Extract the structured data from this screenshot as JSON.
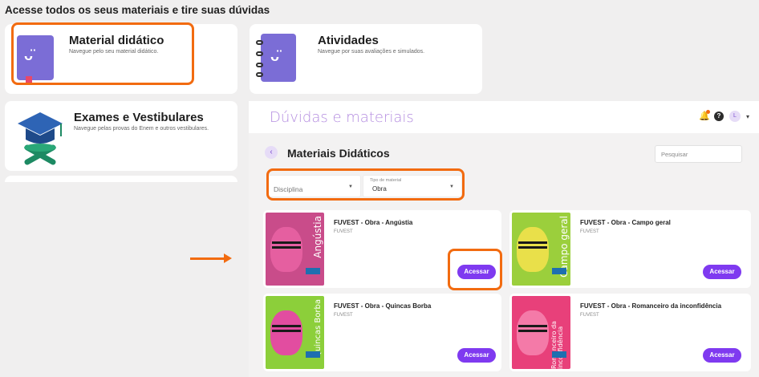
{
  "heading": "Acesse todos os seus materiais e tire suas dúvidas",
  "cards": {
    "material": {
      "title": "Material didático",
      "desc": "Navegue pelo seu material didático."
    },
    "atividades": {
      "title": "Atividades",
      "desc": "Navegue por suas avaliações e simulados."
    },
    "exames": {
      "title": "Exames e Vestibulares",
      "desc": "Navegue pelas provas do Enem e outros vestibulares."
    }
  },
  "panel": {
    "brand": "Dúvidas e materiais",
    "avatar": "L",
    "section_title": "Materiais Didáticos",
    "search_placeholder": "Pesquisar",
    "filters": {
      "disciplina_placeholder": "Disciplina",
      "tipo_label": "Tipo de material",
      "tipo_value": "Obra"
    },
    "materials": [
      {
        "title": "FUVEST - Obra - Angústia",
        "sub": "FUVEST",
        "cover_text": "Angústia",
        "button": "Acessar",
        "cover_colors": [
          "#c94c8a",
          "#e55fa0",
          "#7ad0d6"
        ]
      },
      {
        "title": "FUVEST - Obra - Campo geral",
        "sub": "FUVEST",
        "cover_text": "Campo geral",
        "button": "Acessar",
        "cover_colors": [
          "#9bcf3c",
          "#e9e04a",
          "#55b24a"
        ]
      },
      {
        "title": "FUVEST - Obra - Quincas Borba",
        "sub": "FUVEST",
        "cover_text": "Quincas Borba",
        "button": "Acessar",
        "cover_colors": [
          "#8ccf3a",
          "#e24da0",
          "#b5d94a"
        ]
      },
      {
        "title": "FUVEST - Obra - Romanceiro da inconfidência",
        "sub": "FUVEST",
        "cover_text": "Romanceiro da inconfidência",
        "button": "Acessar",
        "cover_colors": [
          "#e8407a",
          "#f47aa8",
          "#2a6cb8"
        ]
      }
    ]
  },
  "colors": {
    "accent": "#7f3af0",
    "highlight": "#f26b10",
    "brand": "#b58ee0"
  },
  "icons": [
    "bell-icon",
    "help-icon",
    "chevron-left-icon",
    "chevron-down-icon",
    "arrow-right-icon"
  ]
}
